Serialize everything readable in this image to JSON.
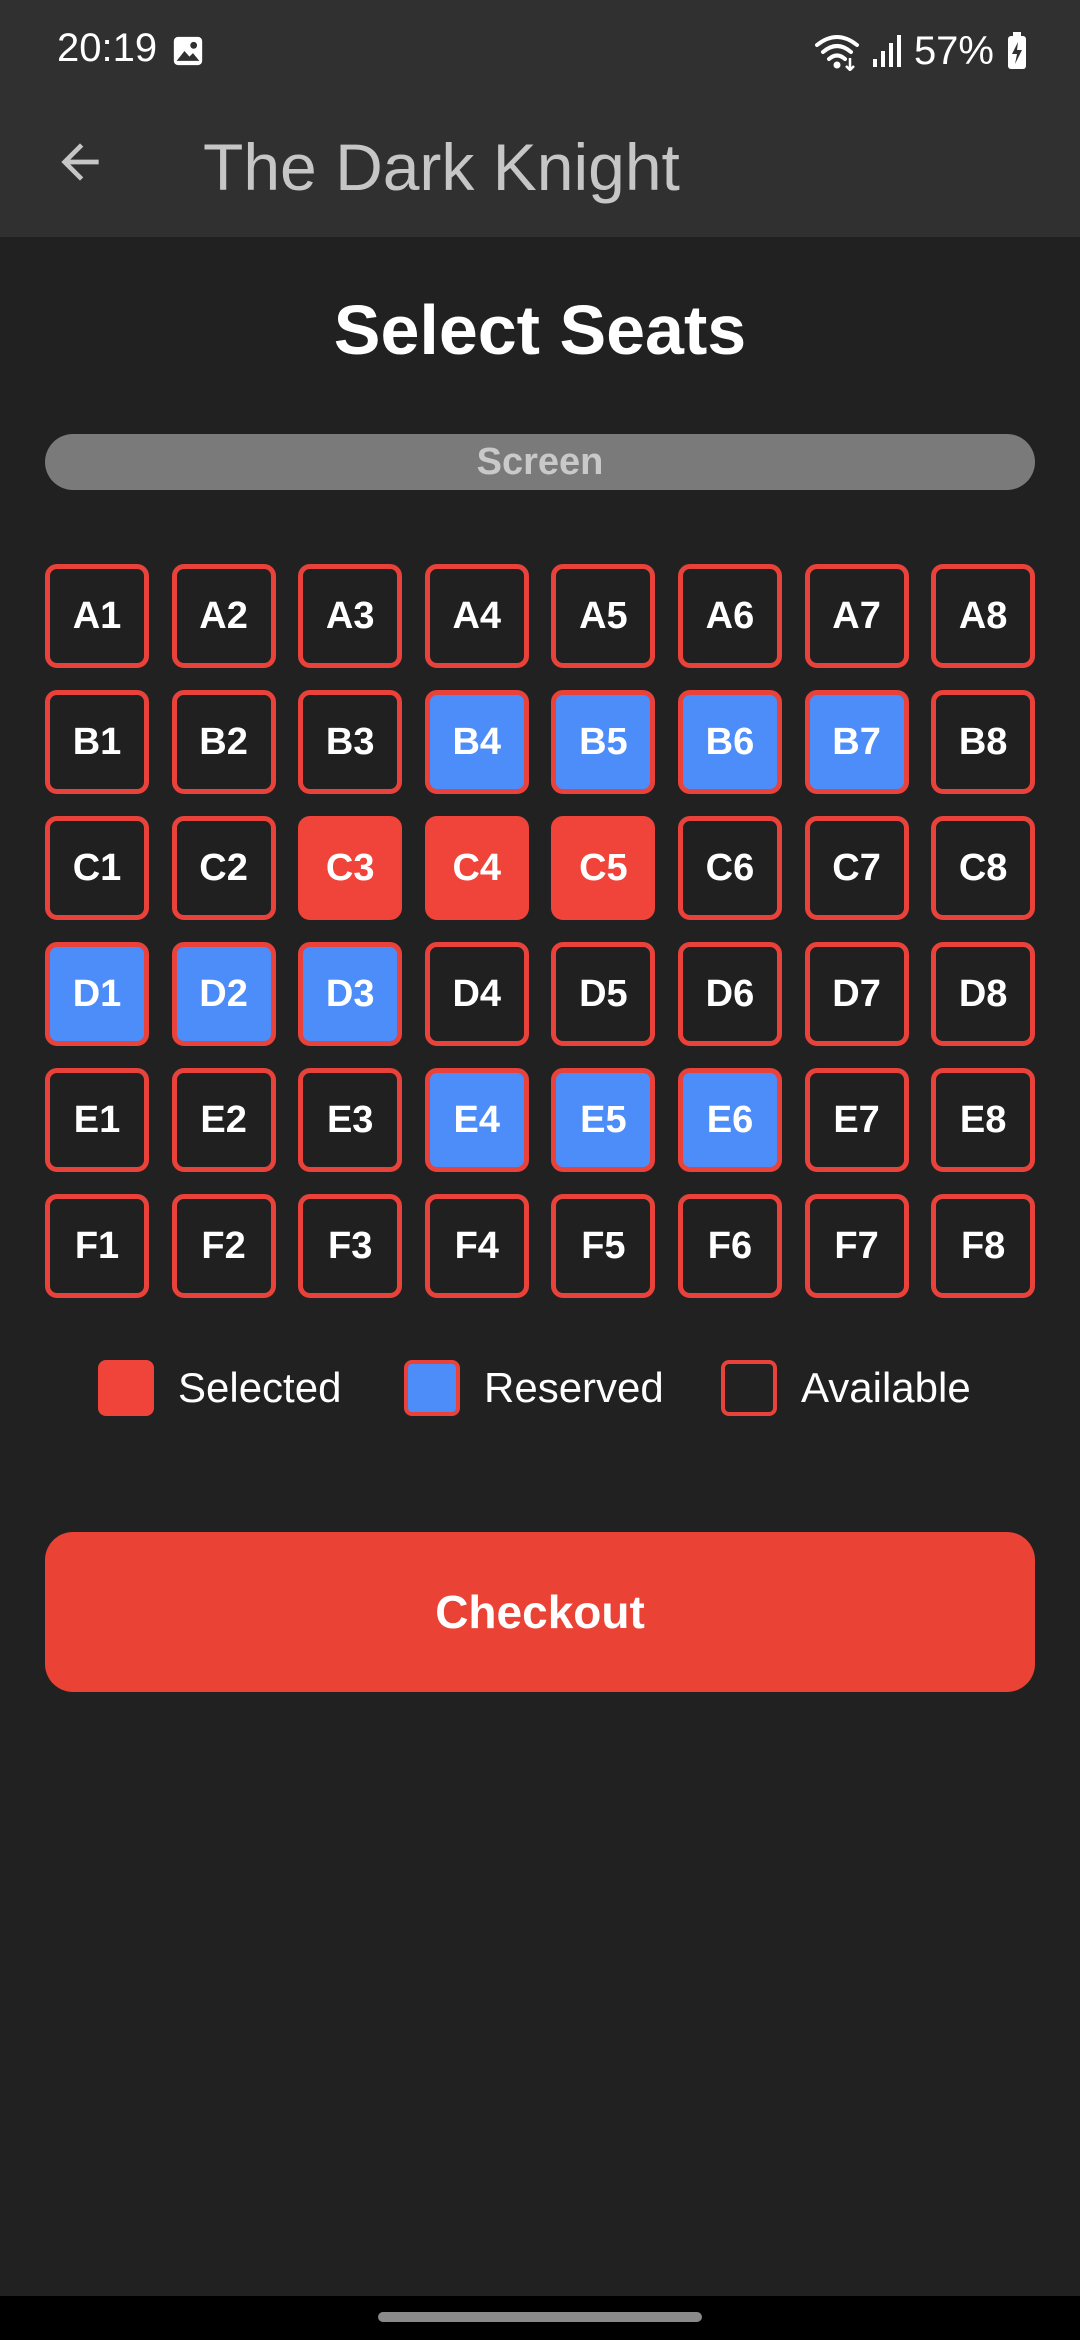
{
  "status_bar": {
    "time": "20:19",
    "battery": "57%",
    "icons": [
      "gallery-icon",
      "wifi-icon",
      "signal-icon",
      "battery-charging-icon"
    ]
  },
  "app_bar": {
    "title": "The Dark Knight",
    "back_icon": "arrow-left-icon"
  },
  "page": {
    "title": "Select Seats",
    "screen_label": "Screen"
  },
  "seats": [
    {
      "label": "A1",
      "status": "available"
    },
    {
      "label": "A2",
      "status": "available"
    },
    {
      "label": "A3",
      "status": "available"
    },
    {
      "label": "A4",
      "status": "available"
    },
    {
      "label": "A5",
      "status": "available"
    },
    {
      "label": "A6",
      "status": "available"
    },
    {
      "label": "A7",
      "status": "available"
    },
    {
      "label": "A8",
      "status": "available"
    },
    {
      "label": "B1",
      "status": "available"
    },
    {
      "label": "B2",
      "status": "available"
    },
    {
      "label": "B3",
      "status": "available"
    },
    {
      "label": "B4",
      "status": "reserved"
    },
    {
      "label": "B5",
      "status": "reserved"
    },
    {
      "label": "B6",
      "status": "reserved"
    },
    {
      "label": "B7",
      "status": "reserved"
    },
    {
      "label": "B8",
      "status": "available"
    },
    {
      "label": "C1",
      "status": "available"
    },
    {
      "label": "C2",
      "status": "available"
    },
    {
      "label": "C3",
      "status": "selected"
    },
    {
      "label": "C4",
      "status": "selected"
    },
    {
      "label": "C5",
      "status": "selected"
    },
    {
      "label": "C6",
      "status": "available"
    },
    {
      "label": "C7",
      "status": "available"
    },
    {
      "label": "C8",
      "status": "available"
    },
    {
      "label": "D1",
      "status": "reserved"
    },
    {
      "label": "D2",
      "status": "reserved"
    },
    {
      "label": "D3",
      "status": "reserved"
    },
    {
      "label": "D4",
      "status": "available"
    },
    {
      "label": "D5",
      "status": "available"
    },
    {
      "label": "D6",
      "status": "available"
    },
    {
      "label": "D7",
      "status": "available"
    },
    {
      "label": "D8",
      "status": "available"
    },
    {
      "label": "E1",
      "status": "available"
    },
    {
      "label": "E2",
      "status": "available"
    },
    {
      "label": "E3",
      "status": "available"
    },
    {
      "label": "E4",
      "status": "reserved"
    },
    {
      "label": "E5",
      "status": "reserved"
    },
    {
      "label": "E6",
      "status": "reserved"
    },
    {
      "label": "E7",
      "status": "available"
    },
    {
      "label": "E8",
      "status": "available"
    },
    {
      "label": "F1",
      "status": "available"
    },
    {
      "label": "F2",
      "status": "available"
    },
    {
      "label": "F3",
      "status": "available"
    },
    {
      "label": "F4",
      "status": "available"
    },
    {
      "label": "F5",
      "status": "available"
    },
    {
      "label": "F6",
      "status": "available"
    },
    {
      "label": "F7",
      "status": "available"
    },
    {
      "label": "F8",
      "status": "available"
    }
  ],
  "legend": {
    "selected_label": "Selected",
    "reserved_label": "Reserved",
    "available_label": "Available"
  },
  "checkout_label": "Checkout",
  "colors": {
    "background": "#212121",
    "app_bar": "#303030",
    "selected": "#f0433a",
    "reserved": "#4c8dfa",
    "seat_border": "#e8423a",
    "checkout": "#ea4335",
    "screen_bar": "#7a7a7a"
  }
}
